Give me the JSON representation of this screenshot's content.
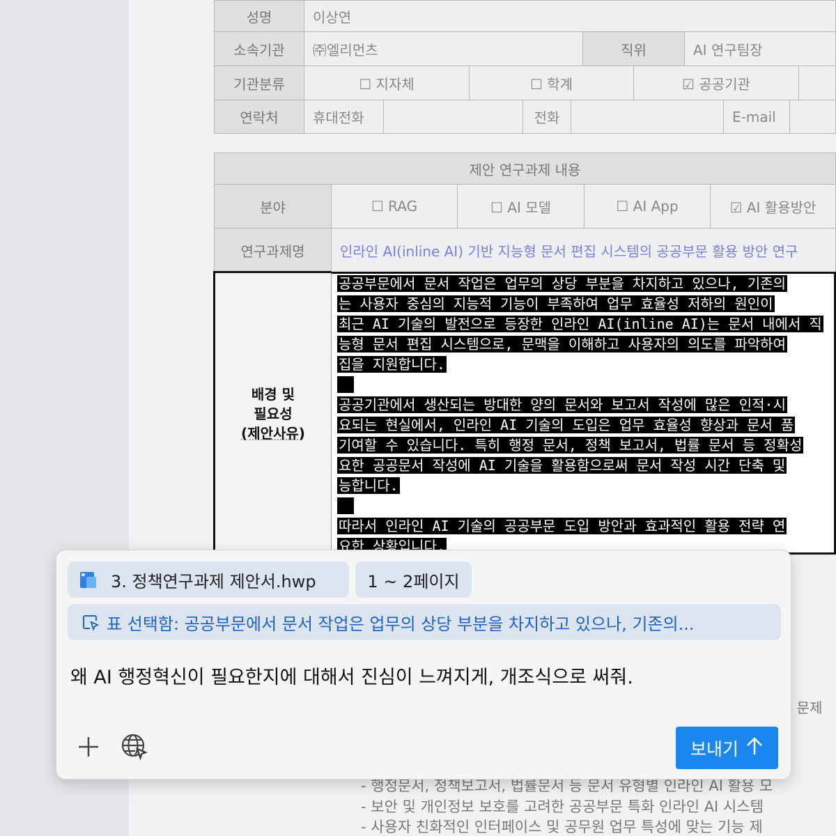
{
  "form": {
    "name_label": "성명",
    "name_value": "이상연",
    "org_label": "소속기관",
    "org_value": "㈜엘리먼츠",
    "position_label": "직위",
    "position_value": "AI 연구팀장",
    "category_label": "기관분류",
    "category_options": [
      "☐ 지자체",
      "☐ 학계",
      "☑ 공공기관"
    ],
    "contact_label": "연락처",
    "mobile_label": "휴대전화",
    "phone_label": "전화",
    "email_label": "E-mail"
  },
  "proposal": {
    "section_title": "제안 연구과제 내용",
    "field_label": "분야",
    "field_options": [
      "☐ RAG",
      "☐ AI 모델",
      "☐ AI App",
      "☑ AI 활용방안"
    ],
    "title_label": "연구과제명",
    "title_value": "인라인 AI(inline AI) 기반 지능형 문서 편집 시스템의 공공부문 활용 방안 연구",
    "background_label_1": "배경 및",
    "background_label_2": "필요성",
    "background_label_3": "(제안사유)",
    "background_lines": [
      "공공부문에서 문서 작업은 업무의 상당 부분을 차지하고 있으나, 기존의",
      "는 사용자 중심의 지능적 기능이 부족하여 업무 효율성 저하의 원인이",
      "최근 AI 기술의 발전으로 등장한 인라인 AI(inline AI)는 문서 내에서 직",
      "능형 문서 편집 시스템으로, 문맥을 이해하고 사용자의 의도를 파악하여",
      "집을 지원합니다.",
      "",
      "공공기관에서 생산되는 방대한 양의 문서와 보고서 작성에 많은 인적·시",
      "요되는 현실에서, 인라인 AI 기술의 도입은 업무 효율성 향상과 문서 품",
      "기여할 수 있습니다. 특히 행정 문서, 정책 보고서, 법률 문서 등 정확성",
      "요한 공공문서 작성에 AI 기술을 활용함으로써 문서 작성 시간 단축 및",
      "능합니다.",
      "",
      "따라서 인라인 AI 기술의 공공부문 도입 방안과 효과적인 활용 전략 연",
      "요한 상황입니다."
    ],
    "lower_lines": [
      "- 행정문서, 정책보고서, 법률문서 등 문서 유형별 인라인 AI 활용 모",
      "- 보안 및 개인정보 보호를 고려한 공공부문 특화 인라인 AI 시스템",
      "- 사용자 친화적인 인터페이스 및 공무원 업무 특성에 맞는 기능 제"
    ],
    "partial_right_text": "- 문제"
  },
  "assistant": {
    "file_chip": "3. 정책연구과제 제안서.hwp",
    "page_chip": "1 ~ 2페이지",
    "selection_text": "표 선택함: 공공부문에서 문서 작업은 업무의 상당 부분을 차지하고 있으나, 기존의...",
    "prompt_text": "왜 AI 행정혁신이 필요한지에 대해서 진심이 느껴지게, 개조식으로 써줘.",
    "send_label": "보내기",
    "accent_color": "#1b87ee"
  }
}
